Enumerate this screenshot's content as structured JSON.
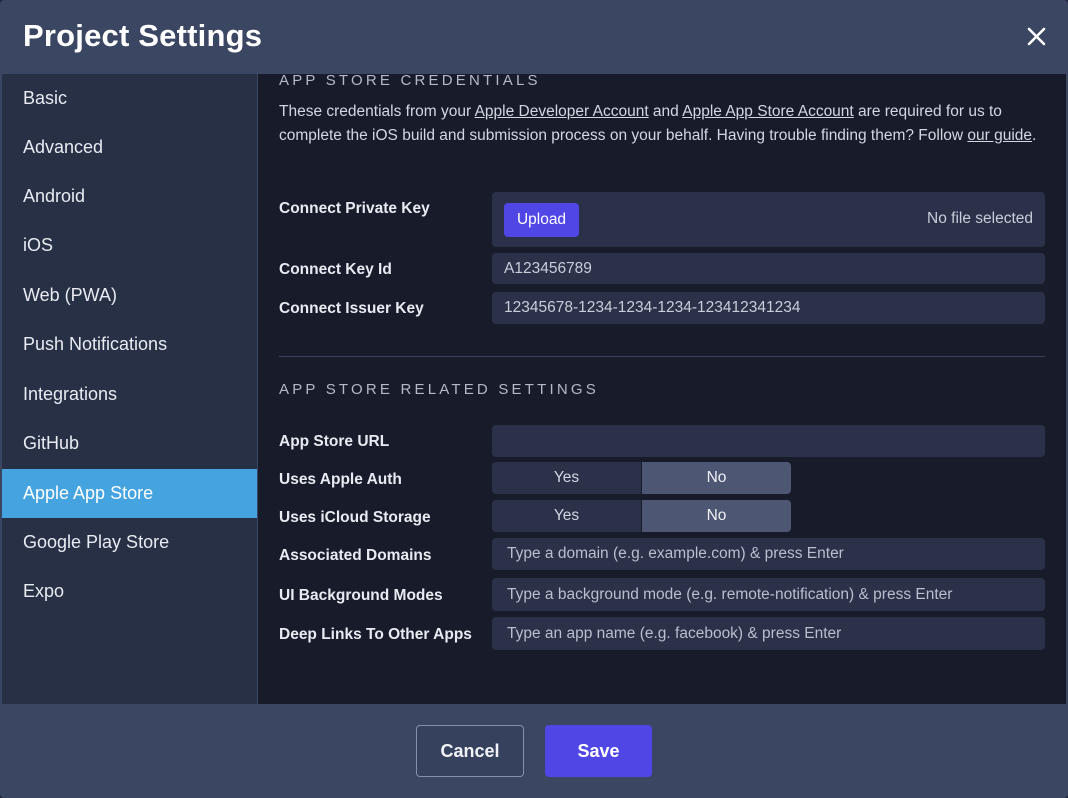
{
  "header": {
    "title": "Project Settings",
    "close_icon": "close-icon"
  },
  "sidebar": {
    "items": [
      {
        "label": "Basic"
      },
      {
        "label": "Advanced"
      },
      {
        "label": "Android"
      },
      {
        "label": "iOS"
      },
      {
        "label": "Web (PWA)"
      },
      {
        "label": "Push Notifications"
      },
      {
        "label": "Integrations"
      },
      {
        "label": "GitHub"
      },
      {
        "label": "Apple App Store",
        "active": true
      },
      {
        "label": "Google Play Store"
      },
      {
        "label": "Expo"
      }
    ]
  },
  "credentials": {
    "section_title": "APP STORE CREDENTIALS",
    "desc_1": "These credentials from your ",
    "link_dev": "Apple Developer Account",
    "desc_2": " and ",
    "link_store": "Apple App Store Account",
    "desc_3": " are required for us to complete the iOS build and submission process on your behalf. Having trouble finding them? Follow ",
    "link_guide": "our guide",
    "desc_4": ".",
    "private_key_label": "Connect Private Key",
    "upload_label": "Upload",
    "no_file": "No file selected",
    "key_id_label": "Connect Key Id",
    "key_id_placeholder": "A123456789",
    "issuer_label": "Connect Issuer Key",
    "issuer_placeholder": "12345678-1234-1234-1234-123412341234"
  },
  "related": {
    "section_title": "APP STORE RELATED SETTINGS",
    "url_label": "App Store URL",
    "url_value": "",
    "apple_auth_label": "Uses Apple Auth",
    "icloud_label": "Uses iCloud Storage",
    "yes": "Yes",
    "no": "No",
    "apple_auth_value": "No",
    "icloud_value": "No",
    "domains_label": "Associated Domains",
    "domains_placeholder": "Type a domain (e.g. example.com) & press Enter",
    "bg_modes_label": "UI Background Modes",
    "bg_modes_placeholder": "Type a background mode (e.g. remote-notification) & press Enter",
    "deep_links_label": "Deep Links To Other Apps",
    "deep_links_placeholder": "Type an app name (e.g. facebook) & press Enter"
  },
  "footer": {
    "cancel_label": "Cancel",
    "save_label": "Save"
  },
  "colors": {
    "accent": "#5046e6",
    "active_nav": "#45a3e0"
  }
}
